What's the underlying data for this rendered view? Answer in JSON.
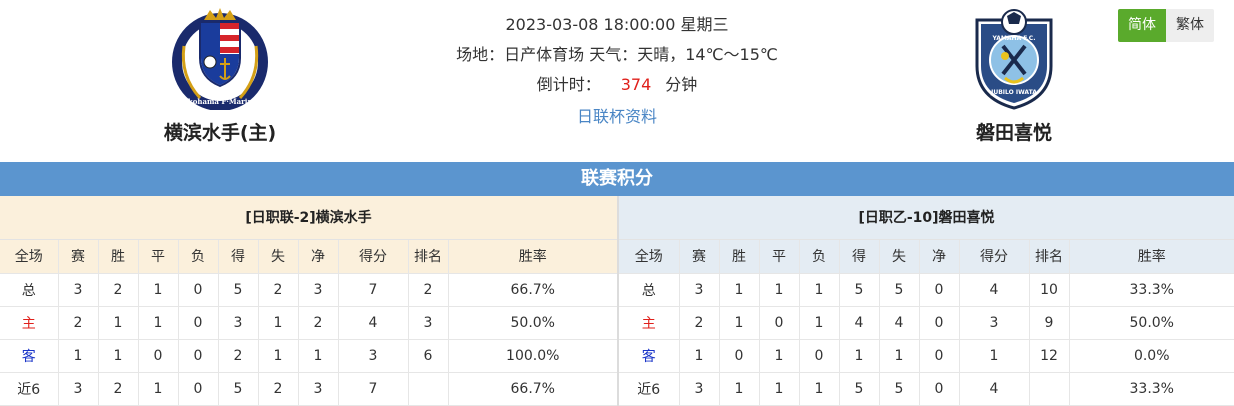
{
  "match": {
    "datetime": "2023-03-08 18:00:00 星期三",
    "venue_line": "场地：日产体育场 天气：天晴，14℃～15℃",
    "countdown_label": "倒计时：",
    "countdown_value": "374",
    "countdown_unit": "分钟",
    "cup_link": "日联杯资料"
  },
  "home_team": {
    "name": "横滨水手(主)",
    "logo_text": "Yokohama F·Marinos"
  },
  "away_team": {
    "name": "磐田喜悦",
    "logo_text_top": "YAMAHA F.C.",
    "logo_text_bottom": "JUBILO IWATA"
  },
  "lang": {
    "simplified": "简体",
    "traditional": "繁体"
  },
  "section_title": "联赛积分",
  "colors": {
    "section_bar": "#5b95cf",
    "lang_active": "#5aaa2c",
    "countdown": "#e0201b",
    "home_label": "#e0201b",
    "away_label": "#1a35c8",
    "link": "#4a86c5"
  },
  "standings": {
    "headers": [
      "全场",
      "赛",
      "胜",
      "平",
      "负",
      "得",
      "失",
      "净",
      "得分",
      "排名",
      "胜率"
    ],
    "home": {
      "title": "[日职联-2]横滨水手",
      "rows": [
        [
          "总",
          "3",
          "2",
          "1",
          "0",
          "5",
          "2",
          "3",
          "7",
          "2",
          "66.7%"
        ],
        [
          "主",
          "2",
          "1",
          "1",
          "0",
          "3",
          "1",
          "2",
          "4",
          "3",
          "50.0%"
        ],
        [
          "客",
          "1",
          "1",
          "0",
          "0",
          "2",
          "1",
          "1",
          "3",
          "6",
          "100.0%"
        ],
        [
          "近6",
          "3",
          "2",
          "1",
          "0",
          "5",
          "2",
          "3",
          "7",
          "",
          "66.7%"
        ]
      ]
    },
    "away": {
      "title": "[日职乙-10]磐田喜悦",
      "rows": [
        [
          "总",
          "3",
          "1",
          "1",
          "1",
          "5",
          "5",
          "0",
          "4",
          "10",
          "33.3%"
        ],
        [
          "主",
          "2",
          "1",
          "0",
          "1",
          "4",
          "4",
          "0",
          "3",
          "9",
          "50.0%"
        ],
        [
          "客",
          "1",
          "0",
          "1",
          "0",
          "1",
          "1",
          "0",
          "1",
          "12",
          "0.0%"
        ],
        [
          "近6",
          "3",
          "1",
          "1",
          "1",
          "5",
          "5",
          "0",
          "4",
          "",
          "33.3%"
        ]
      ]
    }
  }
}
